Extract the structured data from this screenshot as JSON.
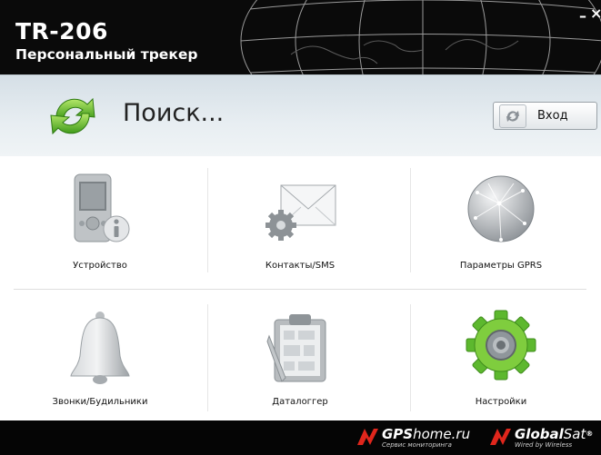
{
  "app": {
    "title": "TR-206",
    "subtitle": "Персональный трекер"
  },
  "window": {
    "minimize_glyph": "–",
    "close_glyph": "×"
  },
  "search": {
    "status": "Поиск...",
    "login_label": "Вход"
  },
  "tiles": [
    {
      "label": "Устройство",
      "icon": "device-info-icon"
    },
    {
      "label": "Контакты/SMS",
      "icon": "envelope-gear-icon"
    },
    {
      "label": "Параметры GPRS",
      "icon": "globe-icon"
    },
    {
      "label": "Звонки/Будильники",
      "icon": "bell-icon"
    },
    {
      "label": "Даталоггер",
      "icon": "clipboard-map-icon"
    },
    {
      "label": "Настройки",
      "icon": "settings-gear-icon"
    }
  ],
  "footer": {
    "gpshome": {
      "brand_bold": "GPS",
      "brand_rest": "home.ru",
      "tagline": "Сервис мониторинга"
    },
    "globalsat": {
      "brand_bold": "Global",
      "brand_rest": "Sat",
      "reg": "®",
      "tagline": "Wired by Wireless"
    }
  },
  "colors": {
    "accent_green": "#5db82e",
    "brand_red": "#e0261c",
    "titlebar": "#0a0a0a"
  }
}
